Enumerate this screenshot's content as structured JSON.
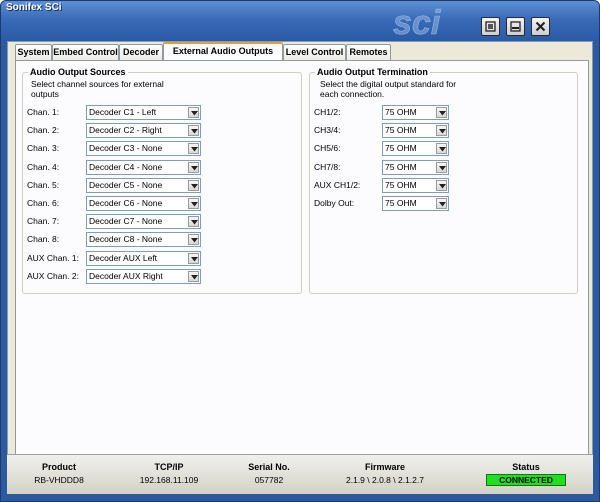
{
  "window": {
    "title": "Sonifex SCi",
    "logo_text": "sci"
  },
  "title_buttons": [
    {
      "icon": "restore-icon"
    },
    {
      "icon": "minimize-icon"
    },
    {
      "icon": "close-icon"
    }
  ],
  "tabs": [
    {
      "label": "System",
      "active": false
    },
    {
      "label": "Embed Control",
      "active": false
    },
    {
      "label": "Decoder",
      "active": false
    },
    {
      "label": "External Audio Outputs",
      "active": true
    },
    {
      "label": "Level Control",
      "active": false
    },
    {
      "label": "Remotes",
      "active": false
    }
  ],
  "sources": {
    "title": "Audio Output Sources",
    "description_lines": [
      "Select channel sources for external",
      "outputs"
    ],
    "rows": [
      {
        "label": "Chan. 1:",
        "value": "Decoder C1 - Left"
      },
      {
        "label": "Chan. 2:",
        "value": "Decoder C2 - Right"
      },
      {
        "label": "Chan. 3:",
        "value": "Decoder C3 - None"
      },
      {
        "label": "Chan. 4:",
        "value": "Decoder C4 - None"
      },
      {
        "label": "Chan. 5:",
        "value": "Decoder C5 - None"
      },
      {
        "label": "Chan. 6:",
        "value": "Decoder C6 - None"
      },
      {
        "label": "Chan. 7:",
        "value": "Decoder C7 - None"
      },
      {
        "label": "Chan. 8:",
        "value": "Decoder C8 - None"
      },
      {
        "label": "AUX Chan. 1:",
        "value": "Decoder AUX Left"
      },
      {
        "label": "AUX Chan. 2:",
        "value": "Decoder AUX Right"
      }
    ]
  },
  "termination": {
    "title": "Audio Output Termination",
    "description_lines": [
      "Select the digital output standard for",
      "each connection."
    ],
    "rows": [
      {
        "label": "CH1/2:",
        "value": "75 OHM"
      },
      {
        "label": "CH3/4:",
        "value": "75 OHM"
      },
      {
        "label": "CH5/6:",
        "value": "75 OHM"
      },
      {
        "label": "CH7/8:",
        "value": "75 OHM"
      },
      {
        "label": "AUX CH1/2:",
        "value": "75 OHM"
      },
      {
        "label": "Dolby Out:",
        "value": "75 OHM"
      }
    ]
  },
  "status_bar": {
    "product": {
      "label": "Product",
      "value": "RB-VHDDD8"
    },
    "tcpip": {
      "label": "TCP/IP",
      "value": "192.168.11.109"
    },
    "serial": {
      "label": "Serial No.",
      "value": "057782"
    },
    "firmware": {
      "label": "Firmware",
      "value": "2.1.9 \\ 2.0.8 \\ 2.1.2.7"
    },
    "status": {
      "label": "Status",
      "value": "CONNECTED"
    }
  },
  "colors": {
    "window_frame": "#2d5a9e",
    "client_bg": "#ece9d8",
    "tab_active_accent": "#e6a02a",
    "connected_green": "#22dd22"
  }
}
